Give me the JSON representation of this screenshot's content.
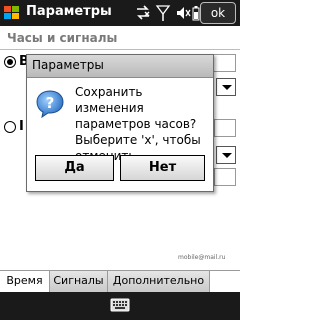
{
  "titlebar": {
    "title": "Параметры",
    "ok_label": "ok"
  },
  "section": {
    "label": "Часы и сигналы"
  },
  "background": {
    "row1_letter": "В",
    "row2_letter": "I"
  },
  "dialog": {
    "title": "Параметры",
    "message": "Сохранить изменения параметров часов? Выберите 'х', чтобы отменить.",
    "yes_label": "Да",
    "no_label": "Нет"
  },
  "watermark": "mobile@mail.ru",
  "tabs": [
    {
      "label": "Время",
      "active": true
    },
    {
      "label": "Сигналы",
      "active": false
    },
    {
      "label": "Дополнительно",
      "active": false
    }
  ],
  "colors": {
    "bar": "#1a1a1a",
    "accent": "#3a7fd0"
  },
  "icons": [
    "windows-logo-icon",
    "connectivity-icon",
    "signal-icon",
    "volume-icon",
    "battery-icon",
    "question-icon",
    "keyboard-icon"
  ]
}
